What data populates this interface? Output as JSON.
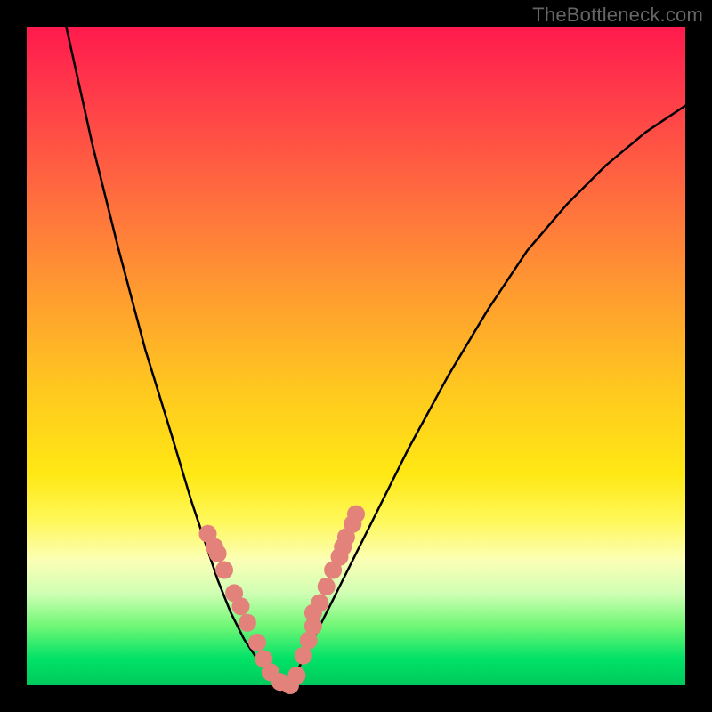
{
  "watermark": "TheBottleneck.com",
  "chart_data": {
    "type": "line",
    "title": "",
    "xlabel": "",
    "ylabel": "",
    "xlim": [
      0,
      1
    ],
    "ylim": [
      0,
      1
    ],
    "grid": false,
    "legend": false,
    "series": [
      {
        "name": "curve",
        "stroke": "#000000",
        "stroke_width": 2.5,
        "x": [
          0.06,
          0.1,
          0.14,
          0.18,
          0.22,
          0.25,
          0.27,
          0.29,
          0.31,
          0.33,
          0.35,
          0.37,
          0.39,
          0.41,
          0.43,
          0.47,
          0.52,
          0.58,
          0.64,
          0.7,
          0.76,
          0.82,
          0.88,
          0.94,
          1.0
        ],
        "y": [
          1.0,
          0.82,
          0.66,
          0.51,
          0.38,
          0.28,
          0.22,
          0.16,
          0.11,
          0.07,
          0.04,
          0.02,
          0.0,
          0.02,
          0.06,
          0.14,
          0.24,
          0.36,
          0.47,
          0.57,
          0.66,
          0.73,
          0.79,
          0.84,
          0.88
        ]
      },
      {
        "name": "dots",
        "type_override": "scatter",
        "marker_color": "#e2827b",
        "marker_radius": 10,
        "x": [
          0.275,
          0.285,
          0.29,
          0.3,
          0.315,
          0.325,
          0.335,
          0.35,
          0.36,
          0.37,
          0.385,
          0.4,
          0.41,
          0.42,
          0.428,
          0.435,
          0.435,
          0.445,
          0.455,
          0.465,
          0.475,
          0.48,
          0.485,
          0.495,
          0.5
        ],
        "y": [
          0.23,
          0.21,
          0.2,
          0.175,
          0.14,
          0.12,
          0.095,
          0.065,
          0.04,
          0.02,
          0.005,
          0.0,
          0.015,
          0.045,
          0.068,
          0.09,
          0.11,
          0.125,
          0.15,
          0.175,
          0.195,
          0.21,
          0.225,
          0.245,
          0.26
        ]
      }
    ]
  },
  "colors": {
    "background_frame": "#000000",
    "watermark": "#666666",
    "curve": "#000000",
    "dots": "#e2827b"
  }
}
